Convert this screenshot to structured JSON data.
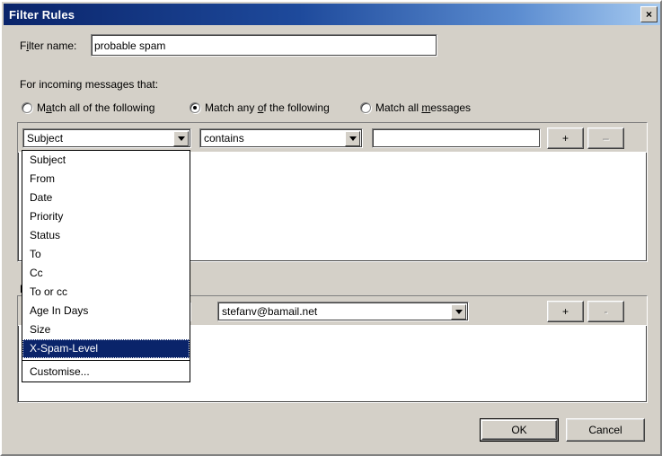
{
  "window": {
    "title": "Filter Rules",
    "close_label": "×",
    "close_icon": "close-icon"
  },
  "filter_name": {
    "label_pre": "F",
    "label_mnemonic": "i",
    "label_post": "lter name:",
    "value": "probable spam"
  },
  "section": {
    "incoming_label": "For incoming messages that:",
    "actions_label_visible": "P"
  },
  "radios": [
    {
      "pre": "M",
      "mnemonic": "a",
      "post": "tch all of the following",
      "checked": false
    },
    {
      "pre": "Match any ",
      "mnemonic": "o",
      "post": "f the following",
      "checked": true
    },
    {
      "pre": "Match all ",
      "mnemonic": "m",
      "post": "essages",
      "checked": false
    }
  ],
  "condition_row": {
    "field_combo_value": "Subject",
    "operator_combo_value": "contains",
    "value_input": "",
    "add_label": "+",
    "remove_label": "–"
  },
  "action_row": {
    "action_combo_value": "",
    "target_combo_value": "stefanv@bamail.net",
    "add_label": "+",
    "remove_label": "-"
  },
  "dropdown": {
    "items": [
      "Subject",
      "From",
      "Date",
      "Priority",
      "Status",
      "To",
      "Cc",
      "To or cc",
      "Age In Days",
      "Size",
      "X-Spam-Level"
    ],
    "selected": "X-Spam-Level",
    "footer_item": "Customise..."
  },
  "footer": {
    "ok_label": "OK",
    "cancel_label": "Cancel"
  },
  "colors": {
    "dialog_bg": "#d4d0c8",
    "title_start": "#0a246a",
    "title_end": "#a6caf0",
    "selection_bg": "#0a246a",
    "field_bg": "#ffffff"
  }
}
